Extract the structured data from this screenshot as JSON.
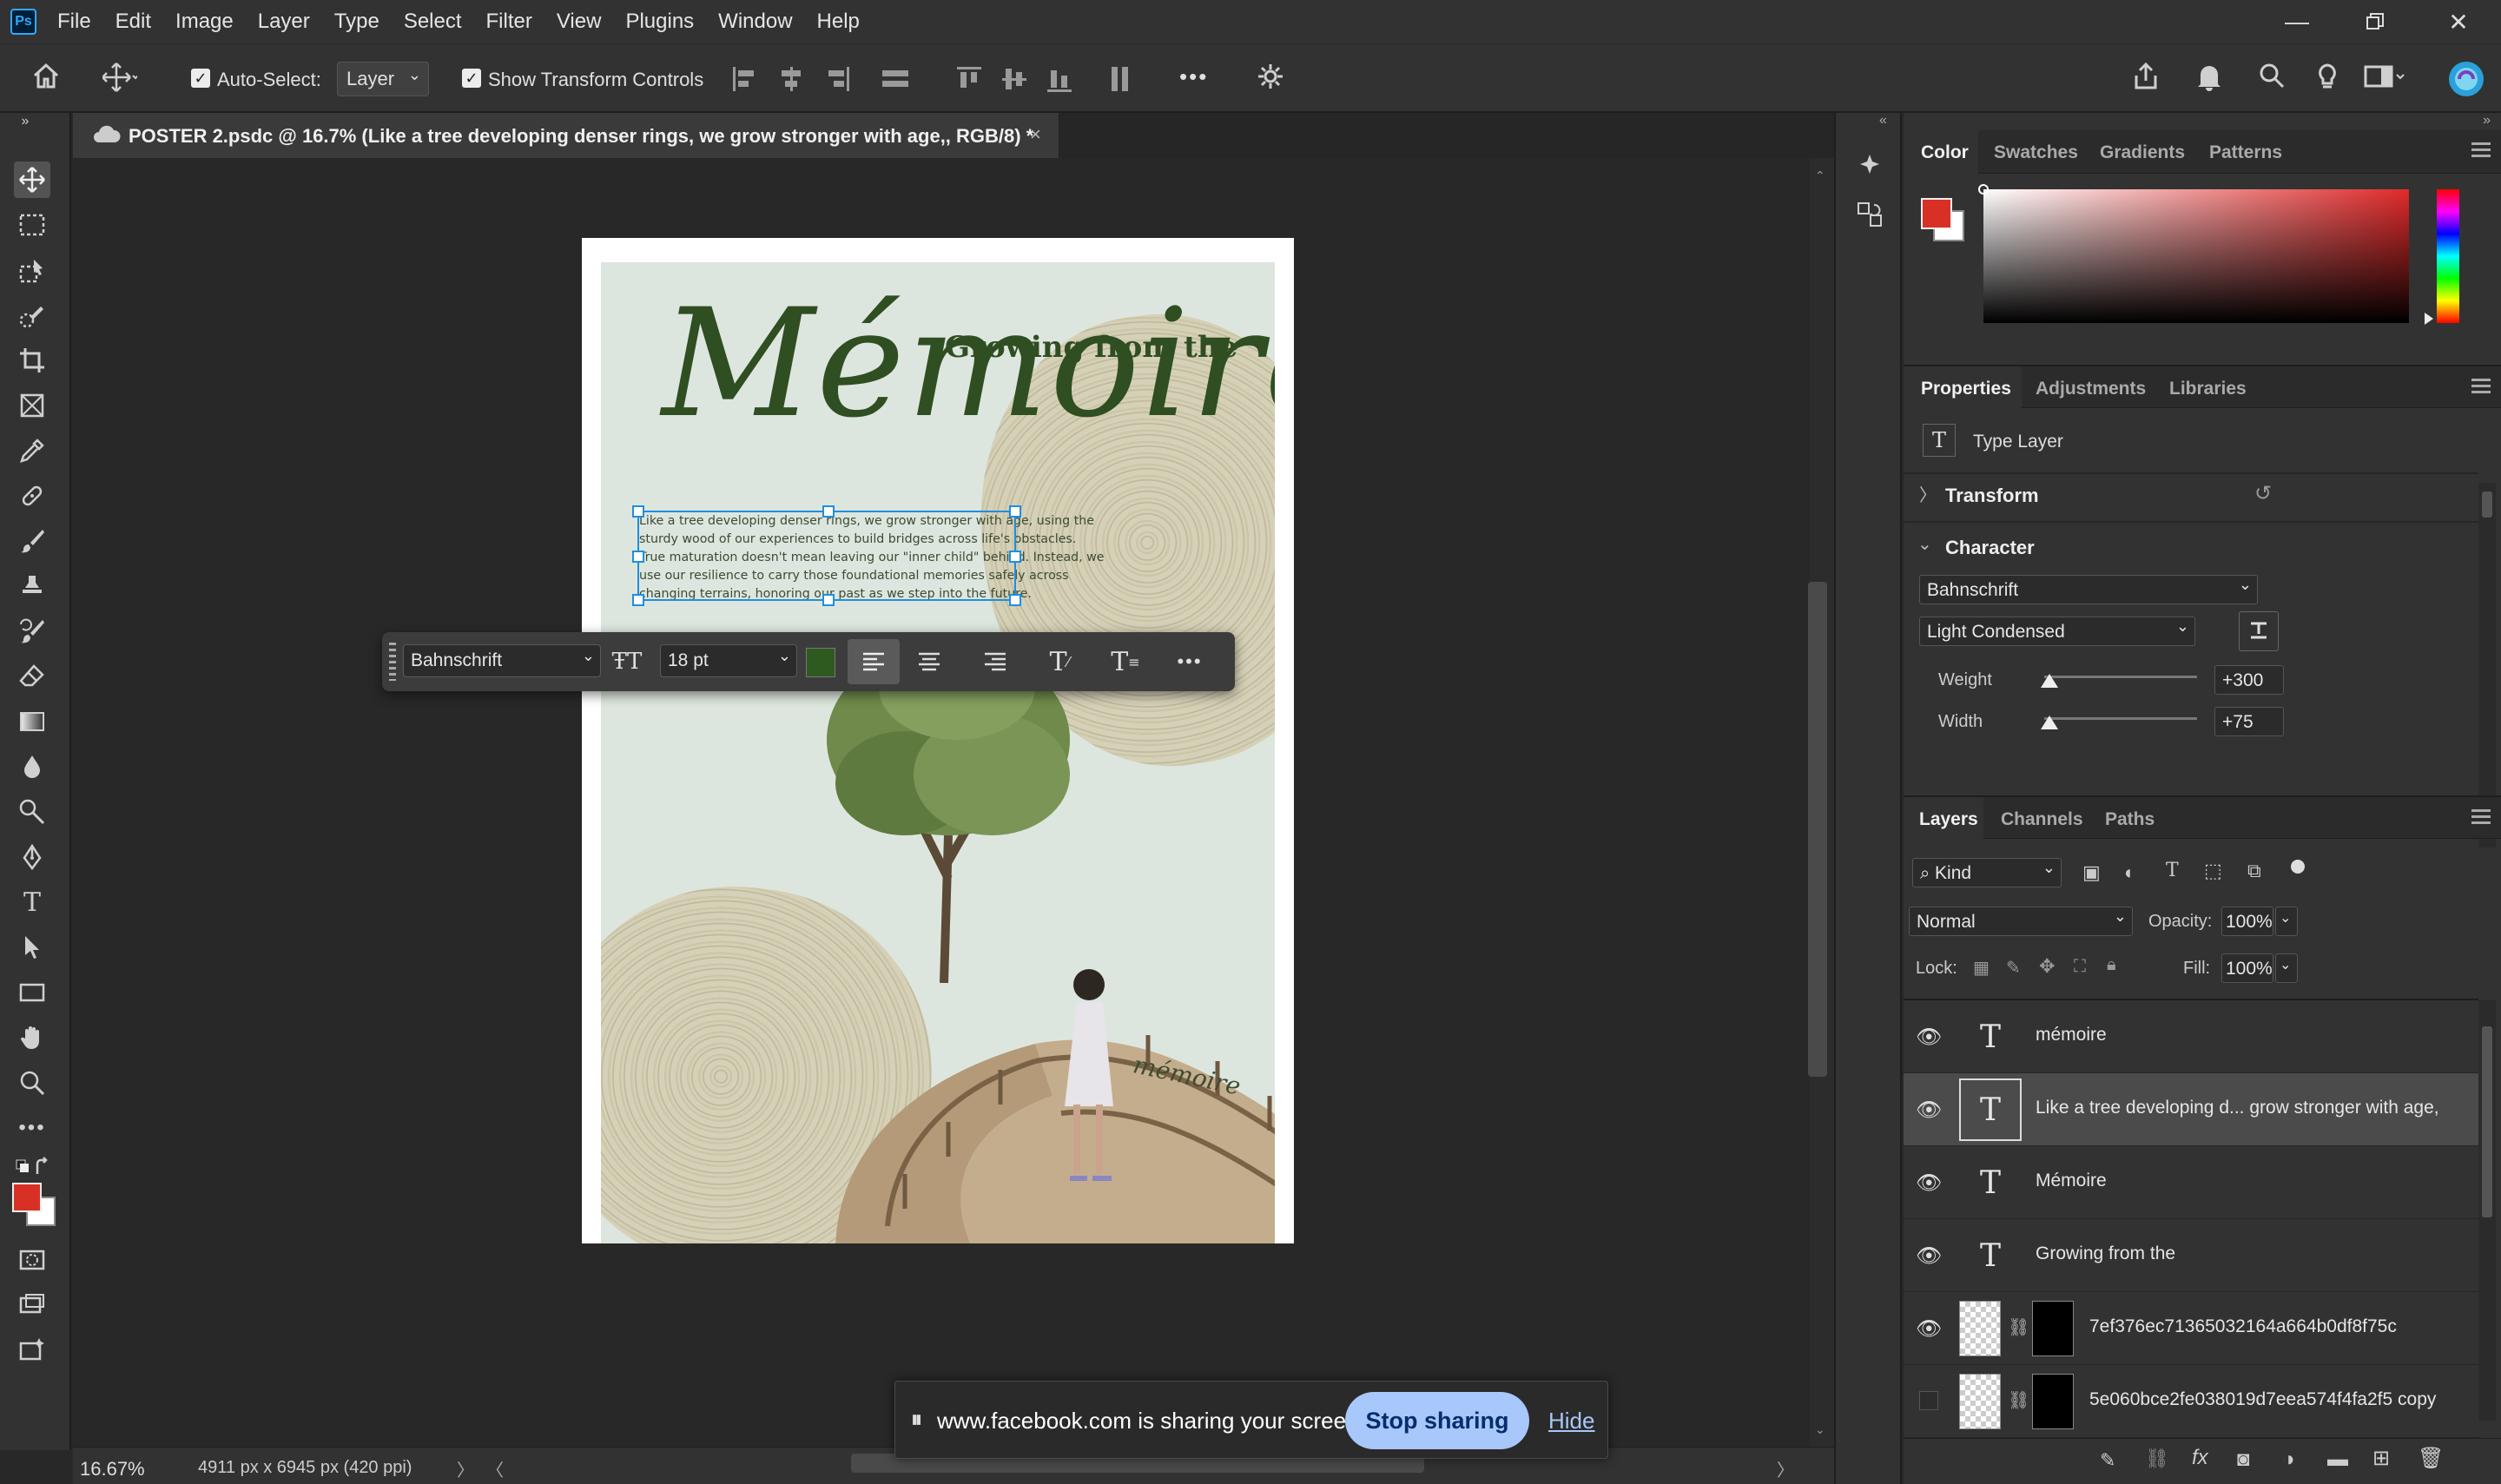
{
  "app": {
    "logo": "Ps",
    "menu": [
      "File",
      "Edit",
      "Image",
      "Layer",
      "Type",
      "Select",
      "Filter",
      "View",
      "Plugins",
      "Window",
      "Help"
    ]
  },
  "options_bar": {
    "auto_select_label": "Auto-Select:",
    "auto_select_checked": true,
    "auto_select_target": "Layer",
    "show_transform_label": "Show Transform Controls",
    "show_transform_checked": true,
    "more_label": "•••"
  },
  "document": {
    "tab_title": "POSTER 2.psdc @ 16.7% (Like a tree developing denser rings, we grow stronger with age,, RGB/8) *",
    "close": "×"
  },
  "poster": {
    "title_script": "Mémoire",
    "subtitle": "Growing from the",
    "body_lines": [
      "Like a tree developing denser rings, we grow stronger with age, using the",
      "sturdy wood of our experiences to build bridges across life's obstacles.",
      "True maturation doesn't mean leaving our \"inner child\" behind. Instead, we",
      "use our resilience to carry those foundational memories safely across",
      "changing terrains, honoring our past as we step into the future."
    ],
    "small_script": "mémoire"
  },
  "context_bar": {
    "font": "Bahnschrift",
    "size": "18 pt",
    "color": "#2f5a1f",
    "more": "•••"
  },
  "status": {
    "zoom": "16.67%",
    "doc_info": "4911 px x 6945 px (420 ppi)"
  },
  "share_banner": {
    "message": "www.facebook.com is sharing your screen.",
    "stop_label": "Stop sharing",
    "hide_label": "Hide"
  },
  "color_panel": {
    "tabs": [
      "Color",
      "Swatches",
      "Gradients",
      "Patterns"
    ],
    "foreground": "#d93025",
    "background": "#ffffff"
  },
  "properties_panel": {
    "tabs": [
      "Properties",
      "Adjustments",
      "Libraries"
    ],
    "layer_kind": "Type Layer",
    "transform_label": "Transform",
    "character_label": "Character",
    "font_family": "Bahnschrift",
    "font_style": "Light Condensed",
    "weight_label": "Weight",
    "weight_value": "+300",
    "width_label": "Width",
    "width_value": "+75"
  },
  "layers_panel": {
    "tabs": [
      "Layers",
      "Channels",
      "Paths"
    ],
    "filter_kind": "Kind",
    "blend_mode": "Normal",
    "opacity_label": "Opacity:",
    "opacity_value": "100%",
    "lock_label": "Lock:",
    "fill_label": "Fill:",
    "fill_value": "100%",
    "layers": [
      {
        "name": "mémoire",
        "kind": "type",
        "visible": true,
        "selected": false
      },
      {
        "name": "Like a tree developing d... grow stronger with age,",
        "kind": "type",
        "visible": true,
        "selected": true
      },
      {
        "name": "Mémoire",
        "kind": "type",
        "visible": true,
        "selected": false
      },
      {
        "name": "Growing from the",
        "kind": "type",
        "visible": true,
        "selected": false
      },
      {
        "name": "7ef376ec71365032164a664b0df8f75c",
        "kind": "image",
        "visible": true,
        "selected": false
      },
      {
        "name": "5e060bce2fe038019d7eea574f4fa2f5 copy",
        "kind": "image",
        "visible": false,
        "selected": false
      }
    ]
  }
}
